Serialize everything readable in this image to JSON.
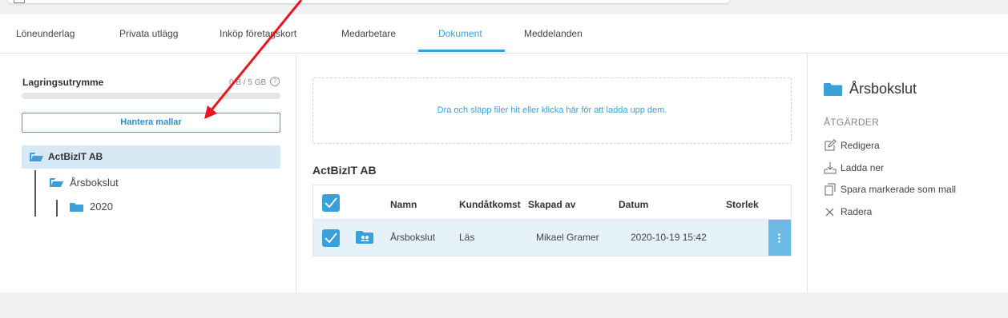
{
  "tabs": [
    {
      "label": "Löneunderlag"
    },
    {
      "label": "Privata utlägg"
    },
    {
      "label": "Inköp företagskort"
    },
    {
      "label": "Medarbetare"
    },
    {
      "label": "Dokument",
      "active": true
    },
    {
      "label": "Meddelanden"
    }
  ],
  "storage": {
    "label": "Lagringsutrymme",
    "value": "0 B / 5 GB",
    "used_fraction": 0,
    "help_icon": "help-icon"
  },
  "manage_templates_button": "Hantera mallar",
  "tree": {
    "root": {
      "label": "ActBizIT AB",
      "icon": "folder-open-icon"
    },
    "children": [
      {
        "label": "Årsbokslut",
        "icon": "folder-open-icon"
      },
      {
        "label": "2020",
        "icon": "folder-icon"
      }
    ]
  },
  "dropzone_text": "Dra och släpp filer hit eller klicka här för att ladda upp dem.",
  "folder_title": "ActBizIT AB",
  "table": {
    "columns": [
      "Namn",
      "Kundåtkomst",
      "Skapad av",
      "Datum",
      "Storlek"
    ],
    "rows": [
      {
        "name": "Årsbokslut",
        "access": "Läs",
        "created_by": "Mikael Gramer",
        "date": "2020-10-19 15:42",
        "size": "",
        "checked": true
      }
    ]
  },
  "details": {
    "title": "Årsbokslut",
    "actions_heading": "ÅTGÄRDER",
    "actions": [
      {
        "label": "Redigera",
        "icon": "edit-icon"
      },
      {
        "label": "Ladda ner",
        "icon": "download-icon"
      },
      {
        "label": "Spara markerade som mall",
        "icon": "copy-icon"
      },
      {
        "label": "Radera",
        "icon": "close-icon"
      }
    ]
  },
  "colors": {
    "accent": "#3aa0d8",
    "selected_row": "#e6f2fa",
    "tree_selected": "#d8e9f6",
    "annotation_arrow": "#e8171e"
  }
}
